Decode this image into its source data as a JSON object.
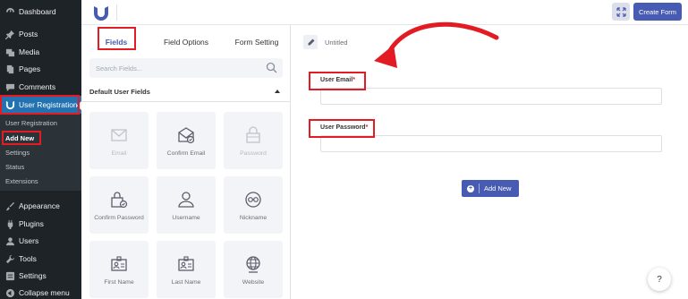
{
  "wp_menu": {
    "items": [
      {
        "label": "Dashboard",
        "icon": "dashboard-icon"
      },
      {
        "label": "Posts",
        "icon": "pin-icon"
      },
      {
        "label": "Media",
        "icon": "media-icon"
      },
      {
        "label": "Pages",
        "icon": "pages-icon"
      },
      {
        "label": "Comments",
        "icon": "comment-icon"
      },
      {
        "label": "User Registration",
        "icon": "user-registration-icon"
      },
      {
        "label": "Appearance",
        "icon": "brush-icon"
      },
      {
        "label": "Plugins",
        "icon": "plug-icon"
      },
      {
        "label": "Users",
        "icon": "users-icon"
      },
      {
        "label": "Tools",
        "icon": "wrench-icon"
      },
      {
        "label": "Settings",
        "icon": "settings-icon"
      },
      {
        "label": "Collapse menu",
        "icon": "collapse-icon"
      }
    ],
    "submenu": [
      "User Registration",
      "Add New",
      "Settings",
      "Status",
      "Extensions"
    ]
  },
  "topbar": {
    "create_form_label": "Create Form"
  },
  "builder": {
    "tabs": [
      "Fields",
      "Field Options",
      "Form Setting"
    ],
    "search_placeholder": "Search Fields...",
    "section_title": "Default User Fields",
    "fields": [
      {
        "label": "Email",
        "icon": "envelope-icon",
        "disabled": true
      },
      {
        "label": "Confirm Email",
        "icon": "envelope-check-icon",
        "disabled": false
      },
      {
        "label": "Password",
        "icon": "lock-icon",
        "disabled": true
      },
      {
        "label": "Confirm Password",
        "icon": "lock-check-icon",
        "disabled": false
      },
      {
        "label": "Username",
        "icon": "user-icon",
        "disabled": false
      },
      {
        "label": "Nickname",
        "icon": "glasses-icon",
        "disabled": false
      },
      {
        "label": "First Name",
        "icon": "id-card-icon",
        "disabled": false
      },
      {
        "label": "Last Name",
        "icon": "id-card-icon",
        "disabled": false
      },
      {
        "label": "Website",
        "icon": "globe-icon",
        "disabled": false
      }
    ]
  },
  "form": {
    "title": "Untitled",
    "fields": [
      {
        "label": "User Email",
        "required_mark": "*"
      },
      {
        "label": "User Password",
        "required_mark": "*"
      }
    ],
    "add_new_label": "Add New",
    "help_label": "?"
  },
  "colors": {
    "accent": "#475bb2",
    "wp_active": "#2271b1",
    "highlight": "#e31b23",
    "sidebar_bg": "#1d2327"
  }
}
